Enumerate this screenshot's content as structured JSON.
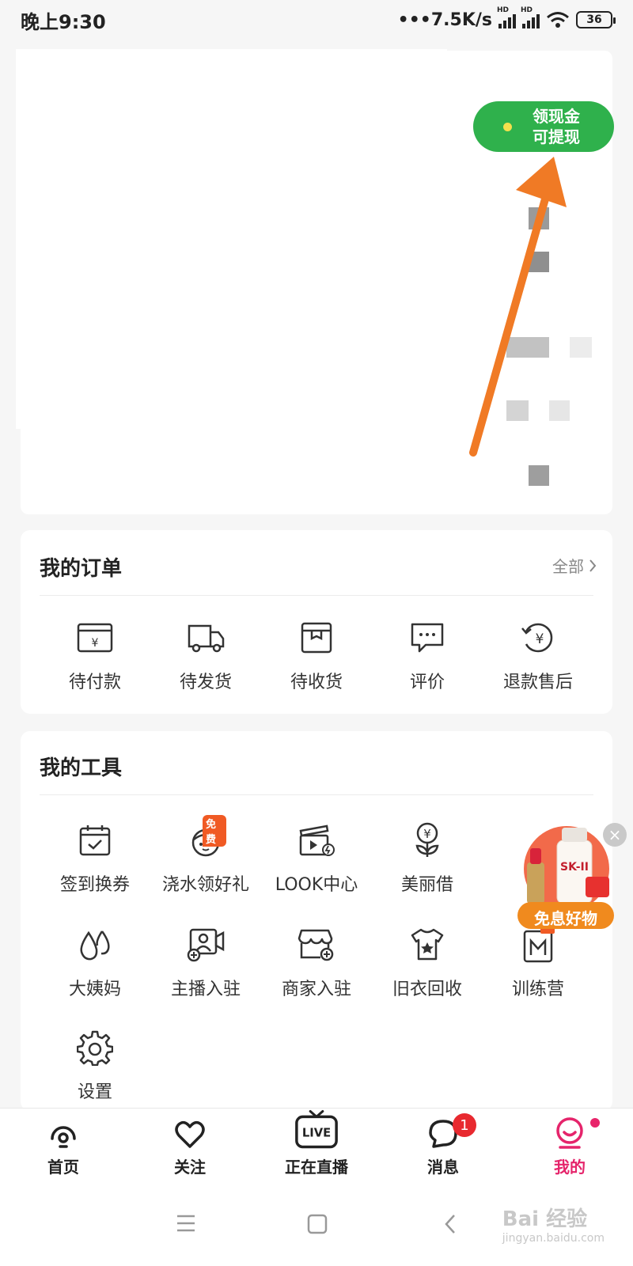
{
  "status_bar": {
    "time": "晚上9:30",
    "network_speed": "•••7.5K/s",
    "signal_label": "HD",
    "battery": "36"
  },
  "profile": {
    "cash_button": {
      "line1": "领现金",
      "line2": "可提现",
      "color": "#2fb14c"
    }
  },
  "orders": {
    "title": "我的订单",
    "all_label": "全部",
    "items": [
      {
        "label": "待付款",
        "icon": "wallet-yen-icon"
      },
      {
        "label": "待发货",
        "icon": "truck-icon"
      },
      {
        "label": "待收货",
        "icon": "box-icon"
      },
      {
        "label": "评价",
        "icon": "comment-icon"
      },
      {
        "label": "退款售后",
        "icon": "refund-yen-icon"
      }
    ]
  },
  "tools": {
    "title": "我的工具",
    "free_tag": "免费",
    "items": [
      {
        "label": "签到换券",
        "icon": "calendar-check-icon"
      },
      {
        "label": "浇水领好礼",
        "icon": "plant-face-icon"
      },
      {
        "label": "LOOK中心",
        "icon": "clapper-icon"
      },
      {
        "label": "美丽借",
        "icon": "yen-flower-icon"
      },
      {
        "label": "大姨妈",
        "icon": "drops-icon"
      },
      {
        "label": "主播入驻",
        "icon": "streamer-icon"
      },
      {
        "label": "商家入驻",
        "icon": "shop-add-icon"
      },
      {
        "label": "旧衣回收",
        "icon": "shirt-star-icon"
      },
      {
        "label": "训练营",
        "icon": "training-icon"
      },
      {
        "label": "设置",
        "icon": "gear-icon"
      }
    ]
  },
  "float_ad": {
    "label": "免息好物",
    "brand": "SK-II"
  },
  "bottom_nav": {
    "items": [
      {
        "label": "首页",
        "icon": "home-icon"
      },
      {
        "label": "关注",
        "icon": "heart-icon"
      },
      {
        "label": "正在直播",
        "icon": "live-tv-icon",
        "live_text": "LIVE"
      },
      {
        "label": "消息",
        "icon": "message-icon",
        "badge": "1"
      },
      {
        "label": "我的",
        "icon": "me-icon",
        "active": true
      }
    ],
    "active_color": "#e5246b"
  },
  "watermark": {
    "main": "Bai 经验",
    "sub": "jingyan.baidu.com"
  }
}
